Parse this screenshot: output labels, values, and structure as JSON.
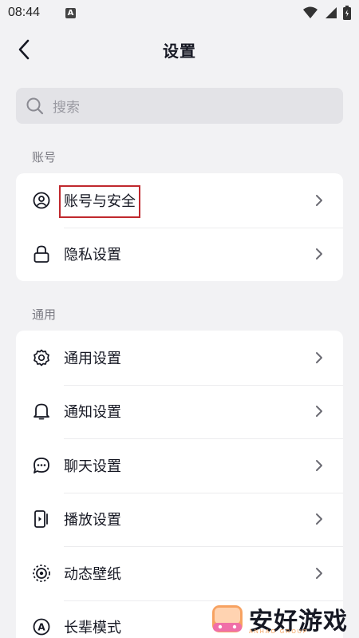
{
  "status_bar": {
    "time": "08:44",
    "notification_letter": "A"
  },
  "header": {
    "title": "设置"
  },
  "search": {
    "placeholder": "搜索"
  },
  "sections": {
    "account": {
      "label": "账号",
      "items": [
        {
          "label": "账号与安全",
          "icon": "user-circle-icon"
        },
        {
          "label": "隐私设置",
          "icon": "lock-icon"
        }
      ]
    },
    "general": {
      "label": "通用",
      "items": [
        {
          "label": "通用设置",
          "icon": "gear-icon"
        },
        {
          "label": "通知设置",
          "icon": "bell-icon"
        },
        {
          "label": "聊天设置",
          "icon": "chat-bubble-icon"
        },
        {
          "label": "播放设置",
          "icon": "play-device-icon"
        },
        {
          "label": "动态壁纸",
          "icon": "wallpaper-icon"
        },
        {
          "label": "长辈模式",
          "icon": "elder-mode-icon"
        }
      ]
    }
  },
  "watermark": {
    "text": "安好游戏",
    "subtext": "ANHAO GROUP"
  },
  "colors": {
    "highlight_box": "#c0282d",
    "background": "#f2f2f4",
    "card": "#ffffff"
  }
}
